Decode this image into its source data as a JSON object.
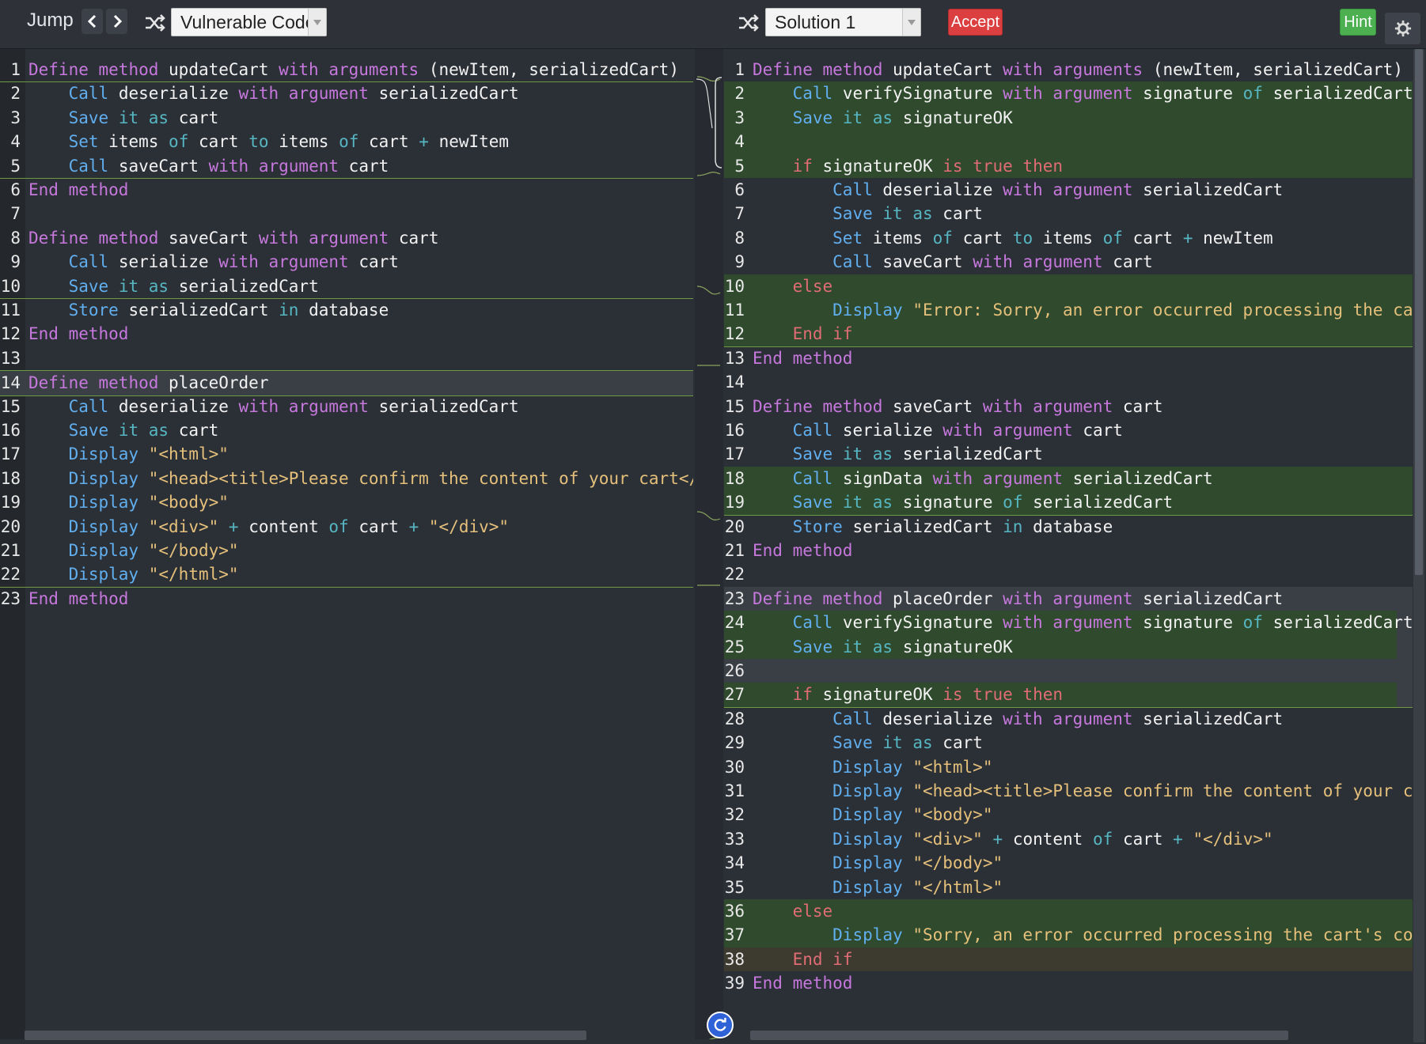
{
  "toolbar": {
    "jump_label": "Jump",
    "left_select_value": "Vulnerable Code",
    "right_select_value": "Solution 1",
    "accept_label": "Accept",
    "hint_label": "Hint"
  },
  "icons": [
    "chevron-left-icon",
    "chevron-right-icon",
    "shuffle-icon",
    "dropdown-arrow-icon",
    "gear-icon",
    "refresh-icon"
  ],
  "colors": {
    "accept": "#dc3f3f",
    "hint": "#4caf50",
    "diff_added": "#2f4a2c",
    "keyword": "#c678dd",
    "function": "#61afef",
    "string": "#e5c07b"
  },
  "left_code": [
    "Define method updateCart with arguments (newItem, serializedCart)",
    "    Call deserialize with argument serializedCart",
    "    Save it as cart",
    "    Set items of cart to items of cart + newItem",
    "    Call saveCart with argument cart",
    "End method",
    "",
    "Define method saveCart with argument cart",
    "    Call serialize with argument cart",
    "    Save it as serializedCart",
    "    Store serializedCart in database",
    "End method",
    "",
    "Define method placeOrder",
    "    Call deserialize with argument serializedCart",
    "    Save it as cart",
    "    Display \"<html>\"",
    "    Display \"<head><title>Please confirm the content of your cart</tit",
    "    Display \"<body>\"",
    "    Display \"<div>\" + content of cart + \"</div>\"",
    "    Display \"</body>\"",
    "    Display \"</html>\"",
    "End method"
  ],
  "right_code": [
    "Define method updateCart with arguments (newItem, serializedCart)",
    "    Call verifySignature with argument signature of serializedCart",
    "    Save it as signatureOK",
    "",
    "    if signatureOK is true then",
    "        Call deserialize with argument serializedCart",
    "        Save it as cart",
    "        Set items of cart to items of cart + newItem",
    "        Call saveCart with argument cart",
    "    else",
    "        Display \"Error: Sorry, an error occurred processing the cart's",
    "    End if",
    "End method",
    "",
    "Define method saveCart with argument cart",
    "    Call serialize with argument cart",
    "    Save it as serializedCart",
    "    Call signData with argument serializedCart",
    "    Save it as signature of serializedCart",
    "    Store serializedCart in database",
    "End method",
    "",
    "Define method placeOrder with argument serializedCart",
    "    Call verifySignature with argument signature of serializedCart",
    "    Save it as signatureOK",
    "",
    "    if signatureOK is true then",
    "        Call deserialize with argument serializedCart",
    "        Save it as cart",
    "        Display \"<html>\"",
    "        Display \"<head><title>Please confirm the content of your cart<",
    "        Display \"<body>\"",
    "        Display \"<div>\" + content of cart + \"</div>\"",
    "        Display \"</body>\"",
    "        Display \"</html>\"",
    "    else",
    "        Display \"Sorry, an error occurred processing the cart's conten",
    "    End if",
    "End method"
  ]
}
